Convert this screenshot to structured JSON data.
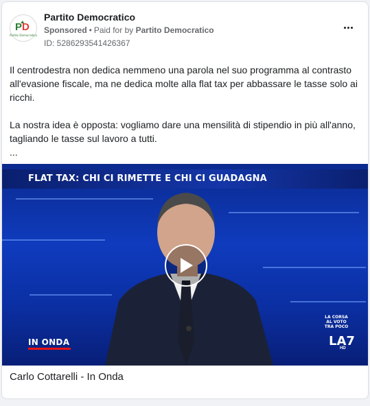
{
  "ad": {
    "page_name": "Partito Democratico",
    "sponsored": "Sponsored",
    "separator": "•",
    "paid_for_prefix": "Paid for by",
    "paid_for_by": "Partito Democratico",
    "ad_id": "ID: 5286293541426367",
    "logo_text": "Partito Democratico",
    "more_icon": "more-horizontal-icon"
  },
  "body": {
    "paragraph_1": "Il centrodestra non dedica nemmeno una parola nel suo programma al contrasto all'evasione fiscale, ma ne dedica molte alla flat tax per abbassare le tasse solo ai ricchi.",
    "paragraph_2": "La nostra idea è opposta: vogliamo dare una mensilità di stipendio in più all'anno, tagliando le tasse sul lavoro a tutti.",
    "ellipsis": "..."
  },
  "video": {
    "banner": "FLAT TAX: CHI CI RIMETTE E CHI CI GUADAGNA",
    "show_logo": "IN ONDA",
    "corner_line_1": "LA CORSA",
    "corner_line_2": "AL VOTO",
    "corner_line_3": "TRA POCO",
    "channel": "LA7",
    "channel_sub": "HD",
    "play_icon": "play-icon"
  },
  "caption": "Carlo Cottarelli - In Onda",
  "colors": {
    "card_bg": "#ffffff",
    "secondary_text": "#65676b",
    "video_blue": "#0f3bbd",
    "logo_green": "#2e7d32",
    "logo_red": "#e53935"
  }
}
